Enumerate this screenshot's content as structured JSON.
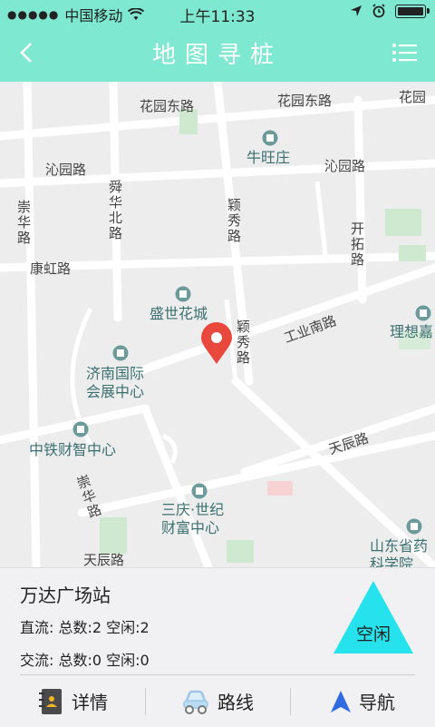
{
  "status": {
    "carrier": "中国移动",
    "time": "上午11:33"
  },
  "nav": {
    "title": "地图寻桩"
  },
  "map": {
    "roads": [
      "花园东路",
      "花园东路",
      "花园",
      "沁园路",
      "沁园路",
      "舜华北路",
      "颖秀路",
      "崇华路",
      "康虹路",
      "开拓路",
      "工业南路",
      "颖秀路",
      "天辰路",
      "崇华路",
      "天辰路"
    ],
    "pois": [
      "牛旺庄",
      "盛世花城",
      "理想嘉",
      "济南国际会展中心",
      "中铁财智中心",
      "三庆·世纪财富中心",
      "山东省药科学院"
    ]
  },
  "station": {
    "name": "万达广场站",
    "dc": "直流: 总数:2  空闲:2",
    "ac": "交流: 总数:0  空闲:0",
    "status": "空闲"
  },
  "actions": {
    "detail": "详情",
    "route": "路线",
    "navigate": "导航"
  },
  "colors": {
    "header": "#7ee8d1",
    "status_triangle": "#25e2ec",
    "pin": "#e9483c",
    "nav_arrow": "#2f6ae0"
  }
}
